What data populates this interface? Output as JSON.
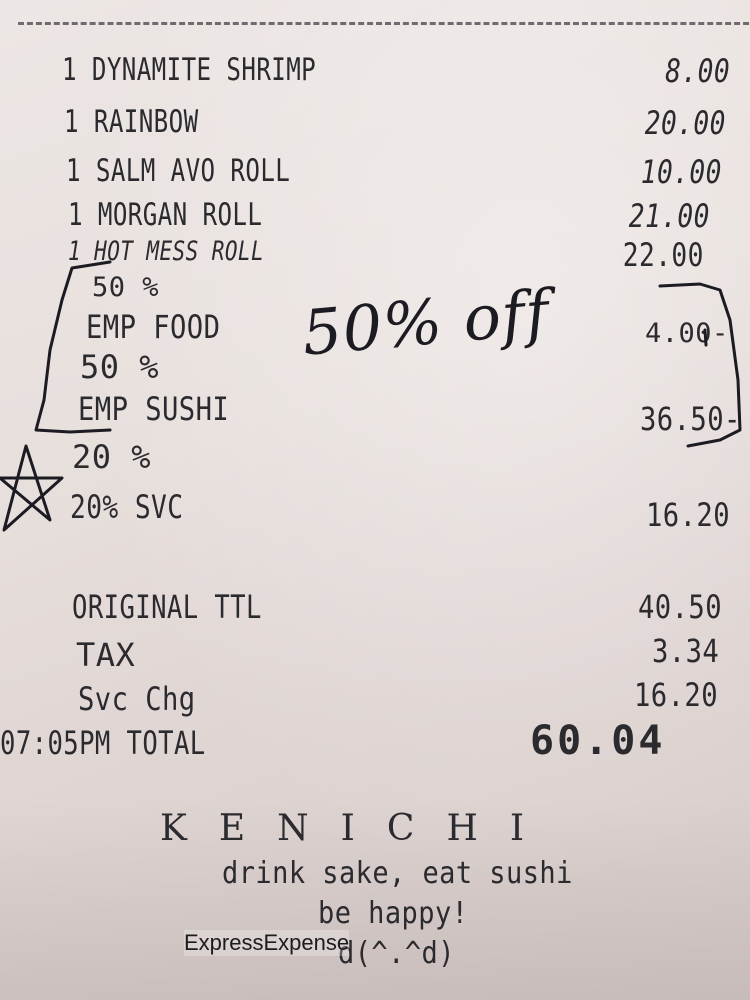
{
  "items": [
    {
      "qty_name": "1 DYNAMITE SHRIMP",
      "price": "8.00"
    },
    {
      "qty_name": "1 RAINBOW",
      "price": "20.00"
    },
    {
      "qty_name": "1 SALM AVO ROLL",
      "price": "10.00"
    },
    {
      "qty_name": "1 MORGAN ROLL",
      "price": "21.00"
    },
    {
      "qty_name": "1 HOT MESS ROLL",
      "price": "22.00"
    }
  ],
  "discounts": [
    {
      "pct": "50 %",
      "label": "EMP FOOD",
      "amount": "4.00-"
    },
    {
      "pct": "50 %",
      "label": "EMP SUSHI",
      "amount": "36.50-"
    }
  ],
  "service": {
    "pct": "20 %",
    "label": "20% SVC",
    "amount": "16.20"
  },
  "summary": {
    "original_label": "ORIGINAL TTL",
    "original_amount": "40.50",
    "tax_label": "TAX",
    "tax_amount": "3.34",
    "svc_label": "Svc Chg",
    "svc_amount": "16.20",
    "total_label": "07:05PM TOTAL",
    "total_amount": "60.04"
  },
  "footer": {
    "brand": "KENICHI",
    "line1": "drink sake, eat sushi",
    "line2": "be happy!",
    "line3": "d(^.^d)"
  },
  "handwritten_note": "50% off",
  "watermark": "ExpressExpense"
}
